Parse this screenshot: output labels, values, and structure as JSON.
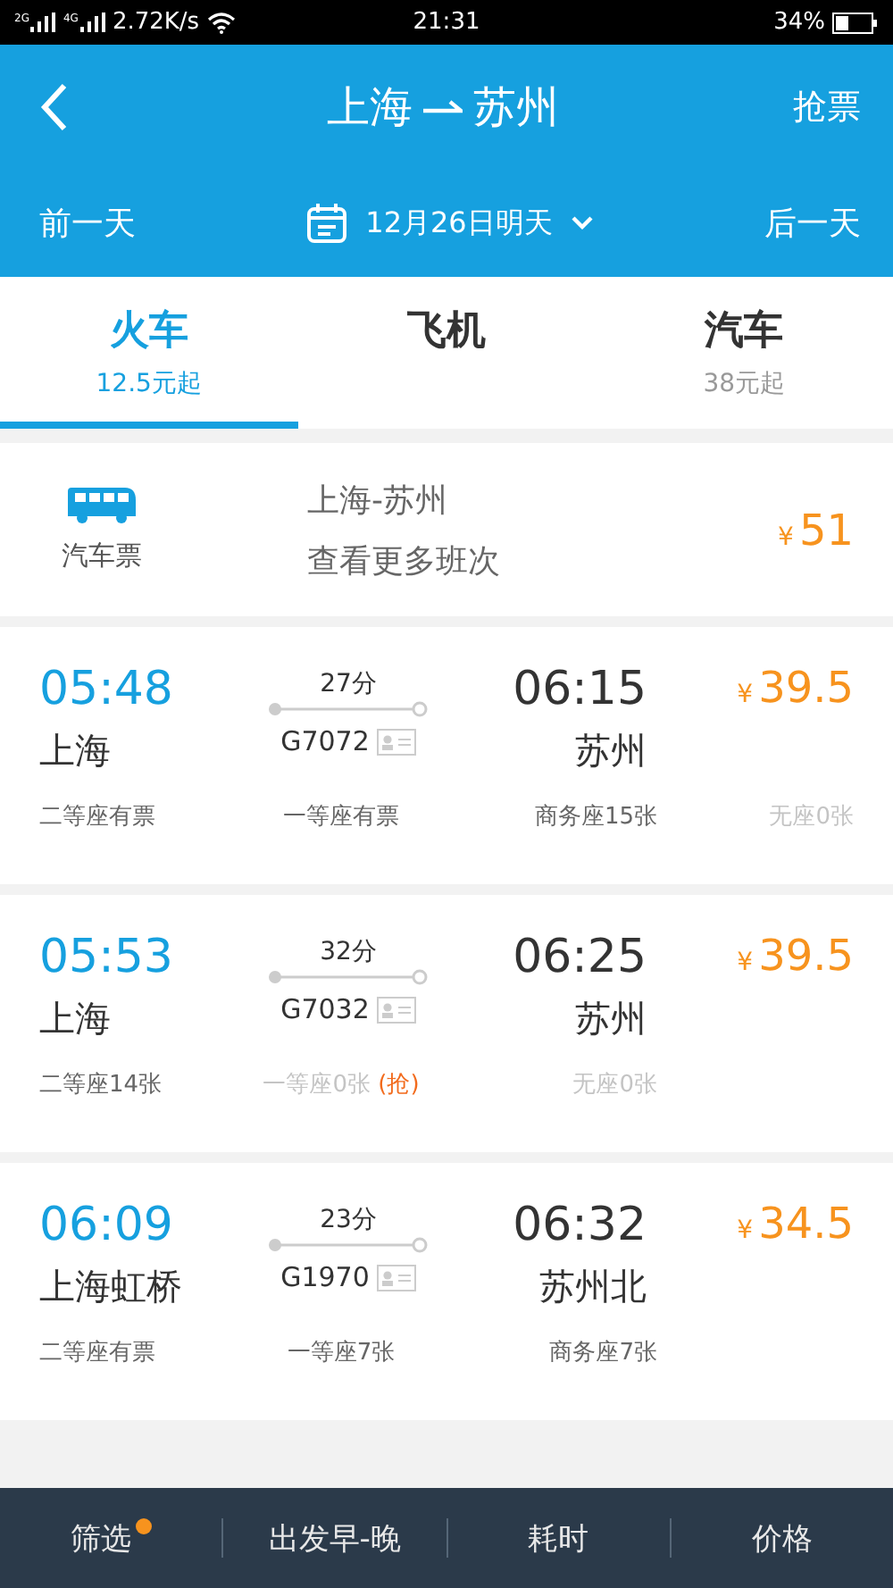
{
  "status_bar": {
    "networks": [
      "2G",
      "4G"
    ],
    "speed": "2.72K/s",
    "time": "21:31",
    "battery": "34%"
  },
  "header": {
    "title_from": "上海",
    "title_to": "苏州",
    "action": "抢票",
    "prev_day": "前一天",
    "date": "12月26日明天",
    "next_day": "后一天"
  },
  "tabs": [
    {
      "label": "火车",
      "sub": "12.5元起",
      "selected": true
    },
    {
      "label": "飞机",
      "selected": false
    },
    {
      "label": "汽车",
      "sub": "38元起",
      "selected": false
    }
  ],
  "bus_card": {
    "label": "汽车票",
    "route": "上海-苏州",
    "more": "查看更多班次",
    "currency": "¥",
    "price": "51"
  },
  "trains": [
    {
      "dep_time": "05:48",
      "dep_station": "上海",
      "duration": "27分",
      "number": "G7072",
      "arr_time": "06:15",
      "arr_station": "苏州",
      "currency": "¥",
      "price": "39.5",
      "seats": [
        {
          "text": "二等座有票",
          "available": true
        },
        {
          "text": "一等座有票",
          "available": true
        },
        {
          "text": "商务座15张",
          "available": true
        },
        {
          "text": "无座0张",
          "available": false
        }
      ]
    },
    {
      "dep_time": "05:53",
      "dep_station": "上海",
      "duration": "32分",
      "number": "G7032",
      "arr_time": "06:25",
      "arr_station": "苏州",
      "currency": "¥",
      "price": "39.5",
      "seats": [
        {
          "text": "二等座14张",
          "available": true
        },
        {
          "text": "一等座0张",
          "available": false,
          "grab": "(抢)"
        },
        {
          "text": "无座0张",
          "available": false
        }
      ]
    },
    {
      "dep_time": "06:09",
      "dep_station": "上海虹桥",
      "duration": "23分",
      "number": "G1970",
      "arr_time": "06:32",
      "arr_station": "苏州北",
      "currency": "¥",
      "price": "34.5",
      "seats": [
        {
          "text": "二等座有票",
          "available": true
        },
        {
          "text": "一等座7张",
          "available": true
        },
        {
          "text": "商务座7张",
          "available": true
        }
      ]
    }
  ],
  "bottom_bar": [
    {
      "label": "筛选",
      "badge": true
    },
    {
      "label": "出发早-晚",
      "badge": false
    },
    {
      "label": "耗时",
      "badge": false
    },
    {
      "label": "价格",
      "badge": false
    }
  ]
}
